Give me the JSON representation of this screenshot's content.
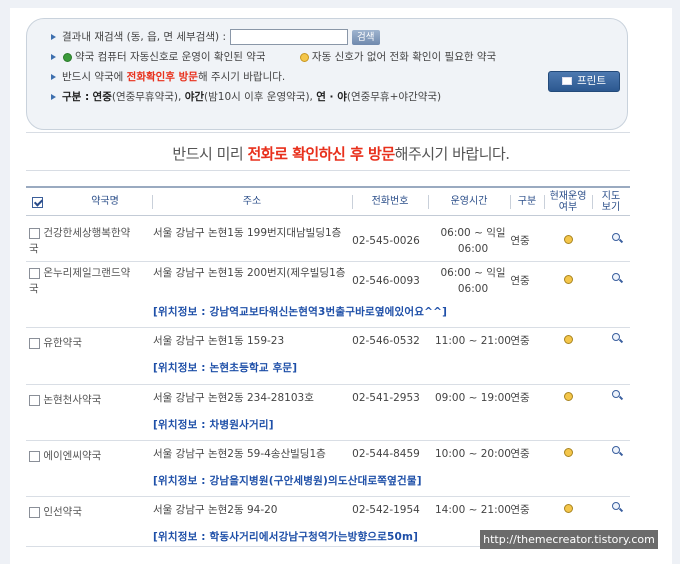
{
  "search": {
    "label": "결과내 재검색 (동, 읍, 면 세부검색) :",
    "value": "",
    "placeholder": "",
    "button": "검색"
  },
  "legend": {
    "green_text": "약국 컴퓨터 자동신호로 운영이 확인된 약국",
    "yellow_text": "자동 신호가 없어 전화 확인이 필요한 약국",
    "notice_pre": "반드시 약국에",
    "notice_red": "전화확인후 방문",
    "notice_post": "해 주시기 바랍니다.",
    "category_label": "구분 :",
    "cat1_bold": "연중",
    "cat1_rest": "(연중무휴약국),",
    "cat2_bold": "야간",
    "cat2_rest": "(밤10시 이후 운영약국),",
    "cat3_bold": "연 · 야",
    "cat3_rest": "(연중무휴+야간약국)"
  },
  "print_button": "프린트",
  "banner": {
    "pre": "반드시 미리",
    "red": "전화로 확인하신 후 방문",
    "post": "해주시기 바랍니다."
  },
  "table": {
    "headers": {
      "name": "약국명",
      "addr": "주소",
      "tel": "전화번호",
      "time": "운영시간",
      "kind": "구분",
      "status_1": "현재운영",
      "status_2": "여부",
      "map_1": "지도",
      "map_2": "보기"
    },
    "rows": [
      {
        "name": "건강한세상행복한약국",
        "addr": "서울 강남구 논현1동 199번지대남빌딩1층",
        "tel": "02-545-0026",
        "time": "06:00 ~ 익일 06:00",
        "kind": "연중",
        "loc": ""
      },
      {
        "name": "온누리제일그랜드약국",
        "addr": "서울 강남구 논현1동 200번지(제우빌딩1층",
        "tel": "02-546-0093",
        "time": "06:00 ~ 익일 06:00",
        "kind": "연중",
        "loc": "[위치정보 : 강남역교보타워신논현역3번출구바로옆에있어요^^]"
      },
      {
        "name": "유한약국",
        "addr": "서울 강남구 논현1동 159-23",
        "tel": "02-546-0532",
        "time": "11:00 ~ 21:00",
        "kind": "연중",
        "loc": "[위치정보 : 논현초등학교 후문]"
      },
      {
        "name": "논현천사약국",
        "addr": "서울 강남구 논현2동 234-28103호",
        "tel": "02-541-2953",
        "time": "09:00 ~ 19:00",
        "kind": "연중",
        "loc": "[위치정보 : 차병원사거리]"
      },
      {
        "name": "에이엔씨약국",
        "addr": "서울 강남구 논현2동 59-4송산빌딩1층",
        "tel": "02-544-8459",
        "time": "10:00 ~ 20:00",
        "kind": "연중",
        "loc": "[위치정보 : 강남을지병원(구안세병원)의도산대로쪽옆건물]"
      },
      {
        "name": "인선약국",
        "addr": "서울 강남구 논현2동 94-20",
        "tel": "02-542-1954",
        "time": "14:00 ~ 21:00",
        "kind": "연중",
        "loc": "[위치정보 : 학동사거리에서강남구청역가는방향으로50m]"
      }
    ]
  },
  "watermark": "http://themecreator.tistory.com"
}
